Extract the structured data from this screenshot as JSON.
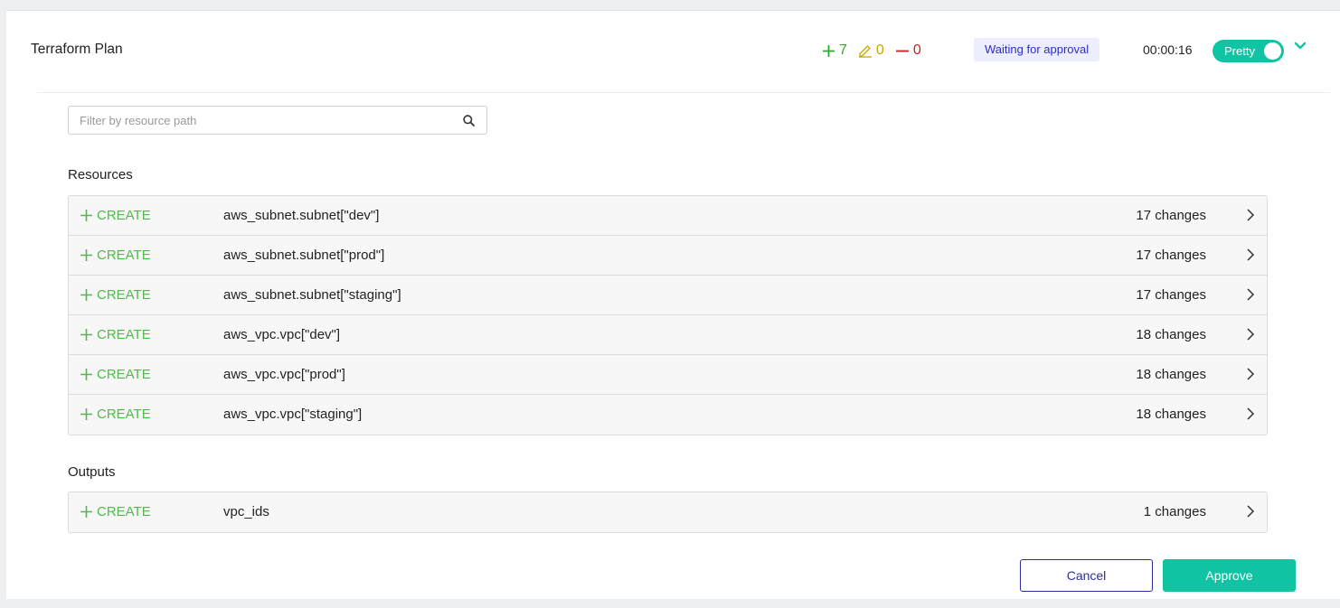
{
  "plan": {
    "title": "Terraform Plan",
    "counts": {
      "add": "7",
      "change": "0",
      "destroy": "0"
    },
    "status_badge": "Waiting for approval",
    "elapsed": "00:00:16",
    "toggle_label": "Pretty",
    "toggle_on": true
  },
  "colors": {
    "accent": "#10c4a3",
    "add": "#2ea82e",
    "change": "#c4a800",
    "destroy": "#cc1f1f",
    "badge_bg": "#ecedfd",
    "badge_text": "#2c2ccf",
    "primary_outline": "#2c2ca8"
  },
  "search": {
    "placeholder": "Filter by resource path",
    "value": ""
  },
  "resources": {
    "title": "Resources",
    "rows": [
      {
        "action": "CREATE",
        "path": "aws_subnet.subnet[\"dev\"]",
        "changes": "17 changes"
      },
      {
        "action": "CREATE",
        "path": "aws_subnet.subnet[\"prod\"]",
        "changes": "17 changes"
      },
      {
        "action": "CREATE",
        "path": "aws_subnet.subnet[\"staging\"]",
        "changes": "17 changes"
      },
      {
        "action": "CREATE",
        "path": "aws_vpc.vpc[\"dev\"]",
        "changes": "18 changes"
      },
      {
        "action": "CREATE",
        "path": "aws_vpc.vpc[\"prod\"]",
        "changes": "18 changes"
      },
      {
        "action": "CREATE",
        "path": "aws_vpc.vpc[\"staging\"]",
        "changes": "18 changes"
      }
    ]
  },
  "outputs": {
    "title": "Outputs",
    "rows": [
      {
        "action": "CREATE",
        "path": "vpc_ids",
        "changes": "1 changes"
      }
    ]
  },
  "buttons": {
    "cancel": "Cancel",
    "approve": "Approve"
  },
  "icons": {
    "add": "plus-icon",
    "change": "pencil-icon",
    "destroy": "minus-icon",
    "search": "search-icon",
    "collapse": "chevron-down-icon",
    "row": "chevron-right-icon"
  }
}
